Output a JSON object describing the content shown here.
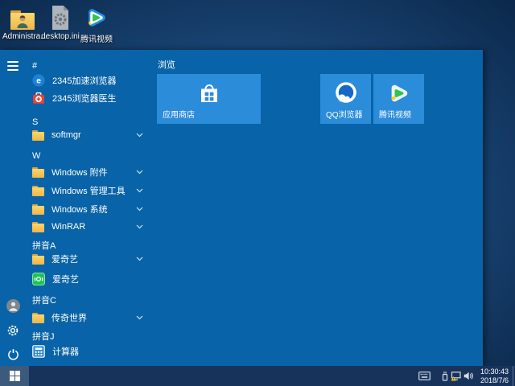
{
  "desktop": {
    "icons": [
      {
        "label": "Administra..."
      },
      {
        "label": "desktop.ini"
      },
      {
        "label": "腾讯视频"
      }
    ]
  },
  "start_menu": {
    "app_list": [
      {
        "type": "header",
        "label": "#"
      },
      {
        "type": "app",
        "label": "2345加速浏览器"
      },
      {
        "type": "app",
        "label": "2345浏览器医生"
      },
      {
        "type": "header",
        "label": "S"
      },
      {
        "type": "folder",
        "label": "softmgr"
      },
      {
        "type": "header",
        "label": "W"
      },
      {
        "type": "folder",
        "label": "Windows 附件"
      },
      {
        "type": "folder",
        "label": "Windows 管理工具"
      },
      {
        "type": "folder",
        "label": "Windows 系统"
      },
      {
        "type": "folder",
        "label": "WinRAR"
      },
      {
        "type": "header",
        "label": "拼音A"
      },
      {
        "type": "folder",
        "label": "爱奇艺"
      },
      {
        "type": "app",
        "label": "爱奇艺"
      },
      {
        "type": "header",
        "label": "拼音C"
      },
      {
        "type": "folder",
        "label": "传奇世界"
      },
      {
        "type": "header",
        "label": "拼音J"
      },
      {
        "type": "app",
        "label": "计算器"
      }
    ],
    "tile_group": {
      "label": "浏览",
      "tiles": [
        {
          "label": "应用商店"
        },
        {
          "label": "QQ浏览器"
        },
        {
          "label": "腾讯视频"
        }
      ]
    }
  },
  "taskbar": {
    "clock": {
      "time": "10:30:43",
      "date": "2018/7/6"
    }
  },
  "colors": {
    "accent": "#0863a8",
    "tile": "#2b8cd9",
    "taskbar": "#17335c",
    "folder": "#f3c95c",
    "warning": "#f8c513"
  }
}
